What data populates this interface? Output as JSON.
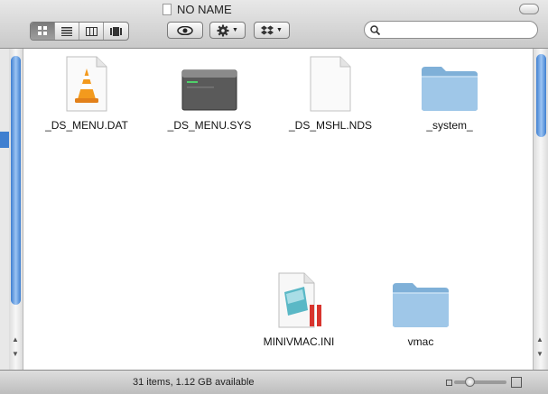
{
  "window": {
    "title": "NO NAME"
  },
  "toolbar": {
    "view_modes": [
      "icon-view",
      "list-view",
      "column-view",
      "coverflow-view"
    ],
    "active_view": "icon-view",
    "quicklook_icon": "eye-icon",
    "action_icon": "gear-icon",
    "dropbox_icon": "dropbox-icon"
  },
  "search": {
    "value": "",
    "placeholder": ""
  },
  "files": [
    {
      "name": "_DS_MENU.DAT",
      "icon": "vlc-cone-icon"
    },
    {
      "name": "_DS_MENU.SYS",
      "icon": "exec-file-icon"
    },
    {
      "name": "_DS_MSHL.NDS",
      "icon": "blank-document-icon"
    },
    {
      "name": "_system_",
      "icon": "folder-icon"
    },
    {
      "name": "MINIVMAC.INI",
      "icon": "ini-document-icon"
    },
    {
      "name": "vmac",
      "icon": "folder-icon"
    }
  ],
  "status": {
    "text": "31 items, 1.12 GB available",
    "zoom_level": 0.25
  },
  "colors": {
    "accent": "#3f7fd0",
    "folder": "#8fb9dc"
  }
}
